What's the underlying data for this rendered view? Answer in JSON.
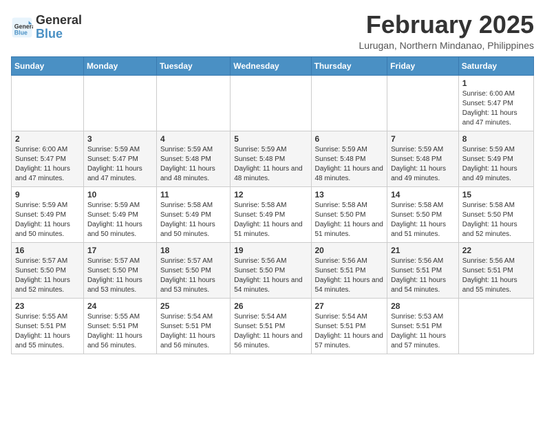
{
  "header": {
    "logo_line1": "General",
    "logo_line2": "Blue",
    "month": "February 2025",
    "location": "Lurugan, Northern Mindanao, Philippines"
  },
  "weekdays": [
    "Sunday",
    "Monday",
    "Tuesday",
    "Wednesday",
    "Thursday",
    "Friday",
    "Saturday"
  ],
  "weeks": [
    [
      {
        "day": "",
        "info": ""
      },
      {
        "day": "",
        "info": ""
      },
      {
        "day": "",
        "info": ""
      },
      {
        "day": "",
        "info": ""
      },
      {
        "day": "",
        "info": ""
      },
      {
        "day": "",
        "info": ""
      },
      {
        "day": "1",
        "info": "Sunrise: 6:00 AM\nSunset: 5:47 PM\nDaylight: 11 hours and 47 minutes."
      }
    ],
    [
      {
        "day": "2",
        "info": "Sunrise: 6:00 AM\nSunset: 5:47 PM\nDaylight: 11 hours and 47 minutes."
      },
      {
        "day": "3",
        "info": "Sunrise: 5:59 AM\nSunset: 5:47 PM\nDaylight: 11 hours and 47 minutes."
      },
      {
        "day": "4",
        "info": "Sunrise: 5:59 AM\nSunset: 5:48 PM\nDaylight: 11 hours and 48 minutes."
      },
      {
        "day": "5",
        "info": "Sunrise: 5:59 AM\nSunset: 5:48 PM\nDaylight: 11 hours and 48 minutes."
      },
      {
        "day": "6",
        "info": "Sunrise: 5:59 AM\nSunset: 5:48 PM\nDaylight: 11 hours and 48 minutes."
      },
      {
        "day": "7",
        "info": "Sunrise: 5:59 AM\nSunset: 5:48 PM\nDaylight: 11 hours and 49 minutes."
      },
      {
        "day": "8",
        "info": "Sunrise: 5:59 AM\nSunset: 5:49 PM\nDaylight: 11 hours and 49 minutes."
      }
    ],
    [
      {
        "day": "9",
        "info": "Sunrise: 5:59 AM\nSunset: 5:49 PM\nDaylight: 11 hours and 50 minutes."
      },
      {
        "day": "10",
        "info": "Sunrise: 5:59 AM\nSunset: 5:49 PM\nDaylight: 11 hours and 50 minutes."
      },
      {
        "day": "11",
        "info": "Sunrise: 5:58 AM\nSunset: 5:49 PM\nDaylight: 11 hours and 50 minutes."
      },
      {
        "day": "12",
        "info": "Sunrise: 5:58 AM\nSunset: 5:49 PM\nDaylight: 11 hours and 51 minutes."
      },
      {
        "day": "13",
        "info": "Sunrise: 5:58 AM\nSunset: 5:50 PM\nDaylight: 11 hours and 51 minutes."
      },
      {
        "day": "14",
        "info": "Sunrise: 5:58 AM\nSunset: 5:50 PM\nDaylight: 11 hours and 51 minutes."
      },
      {
        "day": "15",
        "info": "Sunrise: 5:58 AM\nSunset: 5:50 PM\nDaylight: 11 hours and 52 minutes."
      }
    ],
    [
      {
        "day": "16",
        "info": "Sunrise: 5:57 AM\nSunset: 5:50 PM\nDaylight: 11 hours and 52 minutes."
      },
      {
        "day": "17",
        "info": "Sunrise: 5:57 AM\nSunset: 5:50 PM\nDaylight: 11 hours and 53 minutes."
      },
      {
        "day": "18",
        "info": "Sunrise: 5:57 AM\nSunset: 5:50 PM\nDaylight: 11 hours and 53 minutes."
      },
      {
        "day": "19",
        "info": "Sunrise: 5:56 AM\nSunset: 5:50 PM\nDaylight: 11 hours and 54 minutes."
      },
      {
        "day": "20",
        "info": "Sunrise: 5:56 AM\nSunset: 5:51 PM\nDaylight: 11 hours and 54 minutes."
      },
      {
        "day": "21",
        "info": "Sunrise: 5:56 AM\nSunset: 5:51 PM\nDaylight: 11 hours and 54 minutes."
      },
      {
        "day": "22",
        "info": "Sunrise: 5:56 AM\nSunset: 5:51 PM\nDaylight: 11 hours and 55 minutes."
      }
    ],
    [
      {
        "day": "23",
        "info": "Sunrise: 5:55 AM\nSunset: 5:51 PM\nDaylight: 11 hours and 55 minutes."
      },
      {
        "day": "24",
        "info": "Sunrise: 5:55 AM\nSunset: 5:51 PM\nDaylight: 11 hours and 56 minutes."
      },
      {
        "day": "25",
        "info": "Sunrise: 5:54 AM\nSunset: 5:51 PM\nDaylight: 11 hours and 56 minutes."
      },
      {
        "day": "26",
        "info": "Sunrise: 5:54 AM\nSunset: 5:51 PM\nDaylight: 11 hours and 56 minutes."
      },
      {
        "day": "27",
        "info": "Sunrise: 5:54 AM\nSunset: 5:51 PM\nDaylight: 11 hours and 57 minutes."
      },
      {
        "day": "28",
        "info": "Sunrise: 5:53 AM\nSunset: 5:51 PM\nDaylight: 11 hours and 57 minutes."
      },
      {
        "day": "",
        "info": ""
      }
    ]
  ]
}
